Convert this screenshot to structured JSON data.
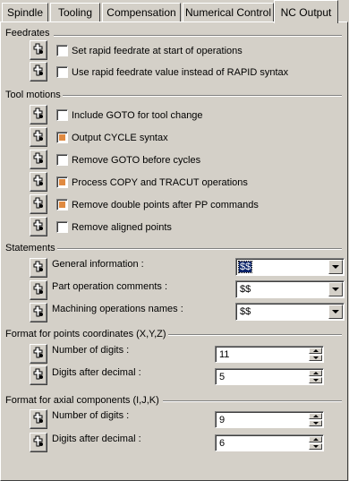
{
  "tabs": [
    "Spindle",
    "Tooling",
    "Compensation",
    "Numerical Control",
    "NC Output"
  ],
  "active_tab": "NC Output",
  "feedrates": {
    "title": "Feedrates",
    "items": [
      {
        "label": "Set rapid feedrate at start of operations",
        "checked": false
      },
      {
        "label": "Use rapid feedrate value instead of RAPID syntax",
        "checked": false
      }
    ]
  },
  "tool_motions": {
    "title": "Tool motions",
    "items": [
      {
        "label": "Include GOTO for tool change",
        "checked": false
      },
      {
        "label": "Output CYCLE syntax",
        "checked": true
      },
      {
        "label": "Remove GOTO before cycles",
        "checked": false
      },
      {
        "label": "Process COPY and TRACUT operations",
        "checked": true
      },
      {
        "label": "Remove double points after PP commands",
        "checked": true
      },
      {
        "label": "Remove aligned points",
        "checked": false
      }
    ]
  },
  "statements": {
    "title": "Statements",
    "items": [
      {
        "label": "General information :",
        "value": "$$"
      },
      {
        "label": "Part operation comments :",
        "value": "$$"
      },
      {
        "label": "Machining operations names :",
        "value": "$$"
      }
    ]
  },
  "points_format": {
    "title": "Format for points coordinates (X,Y,Z)",
    "items": [
      {
        "label": "Number of digits :",
        "value": "11"
      },
      {
        "label": "Digits after decimal :",
        "value": "5"
      }
    ]
  },
  "axial_format": {
    "title": "Format for axial components (I,J,K)",
    "items": [
      {
        "label": "Number of digits :",
        "value": "9"
      },
      {
        "label": "Digits after decimal :",
        "value": "6"
      }
    ]
  },
  "colors": {
    "checked_fill": "#e08a40",
    "background": "#d4d0c8",
    "selection": "#0a246a"
  },
  "icon_name": "lock-formula-icon"
}
